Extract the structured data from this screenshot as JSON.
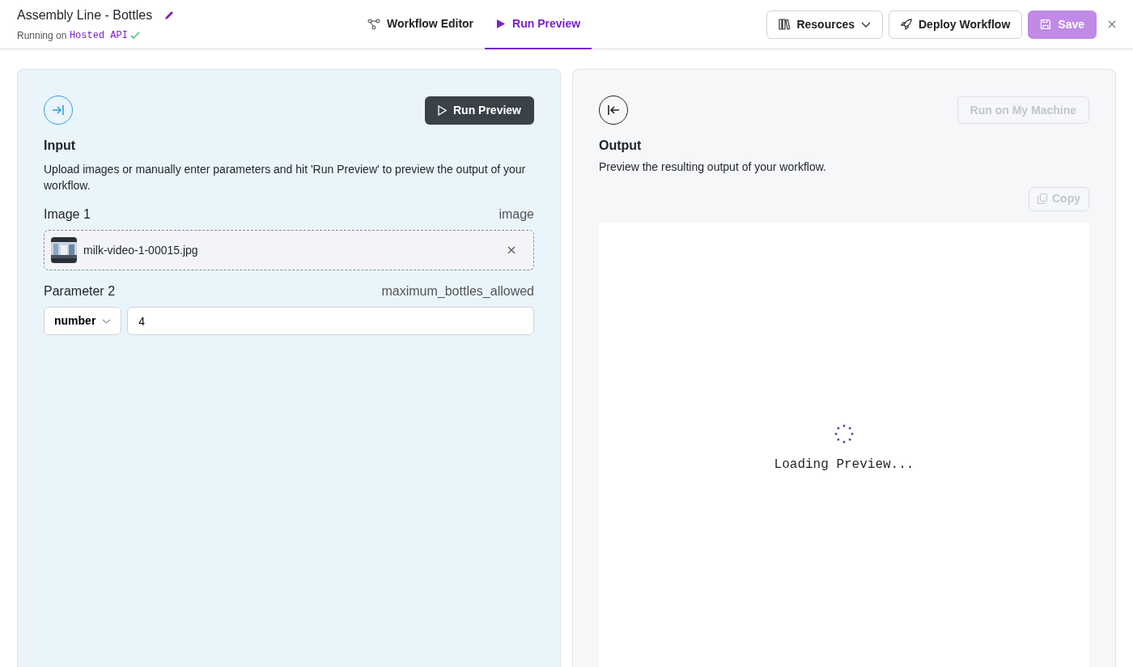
{
  "header": {
    "title": "Assembly Line - Bottles",
    "running_prefix": "Running on",
    "running_target": "Hosted API"
  },
  "tabs": [
    {
      "label": "Workflow Editor",
      "kind": "graph",
      "selected": false
    },
    {
      "label": "Run Preview",
      "kind": "play",
      "selected": true
    }
  ],
  "actions": [
    {
      "label": "Resources",
      "kind": "books",
      "disabled": false
    },
    {
      "label": "Deploy Workflow",
      "kind": "rocket",
      "disabled": false
    },
    {
      "label": "Save",
      "kind": "save",
      "disabled": true
    }
  ],
  "input_panel": {
    "run_button": "Run Preview",
    "title": "Input",
    "description": "Upload images or manually enter parameters and hit 'Run Preview' to preview the output of your workflow.",
    "fields": [
      {
        "label": "Image 1",
        "name": "image",
        "file": "milk-video-1-00015.jpg"
      },
      {
        "kind": "parameter",
        "label": "Parameter 2",
        "name": "maximum_bottles_allowed",
        "type": "number",
        "value": "4"
      }
    ]
  },
  "output_panel": {
    "machine_button": {
      "label": "Run on My Machine",
      "disabled": true
    },
    "title": "Output",
    "description": "Preview the resulting output of your workflow.",
    "copy_button": {
      "label": "Copy",
      "disabled": true
    },
    "loading": "Loading Preview..."
  }
}
